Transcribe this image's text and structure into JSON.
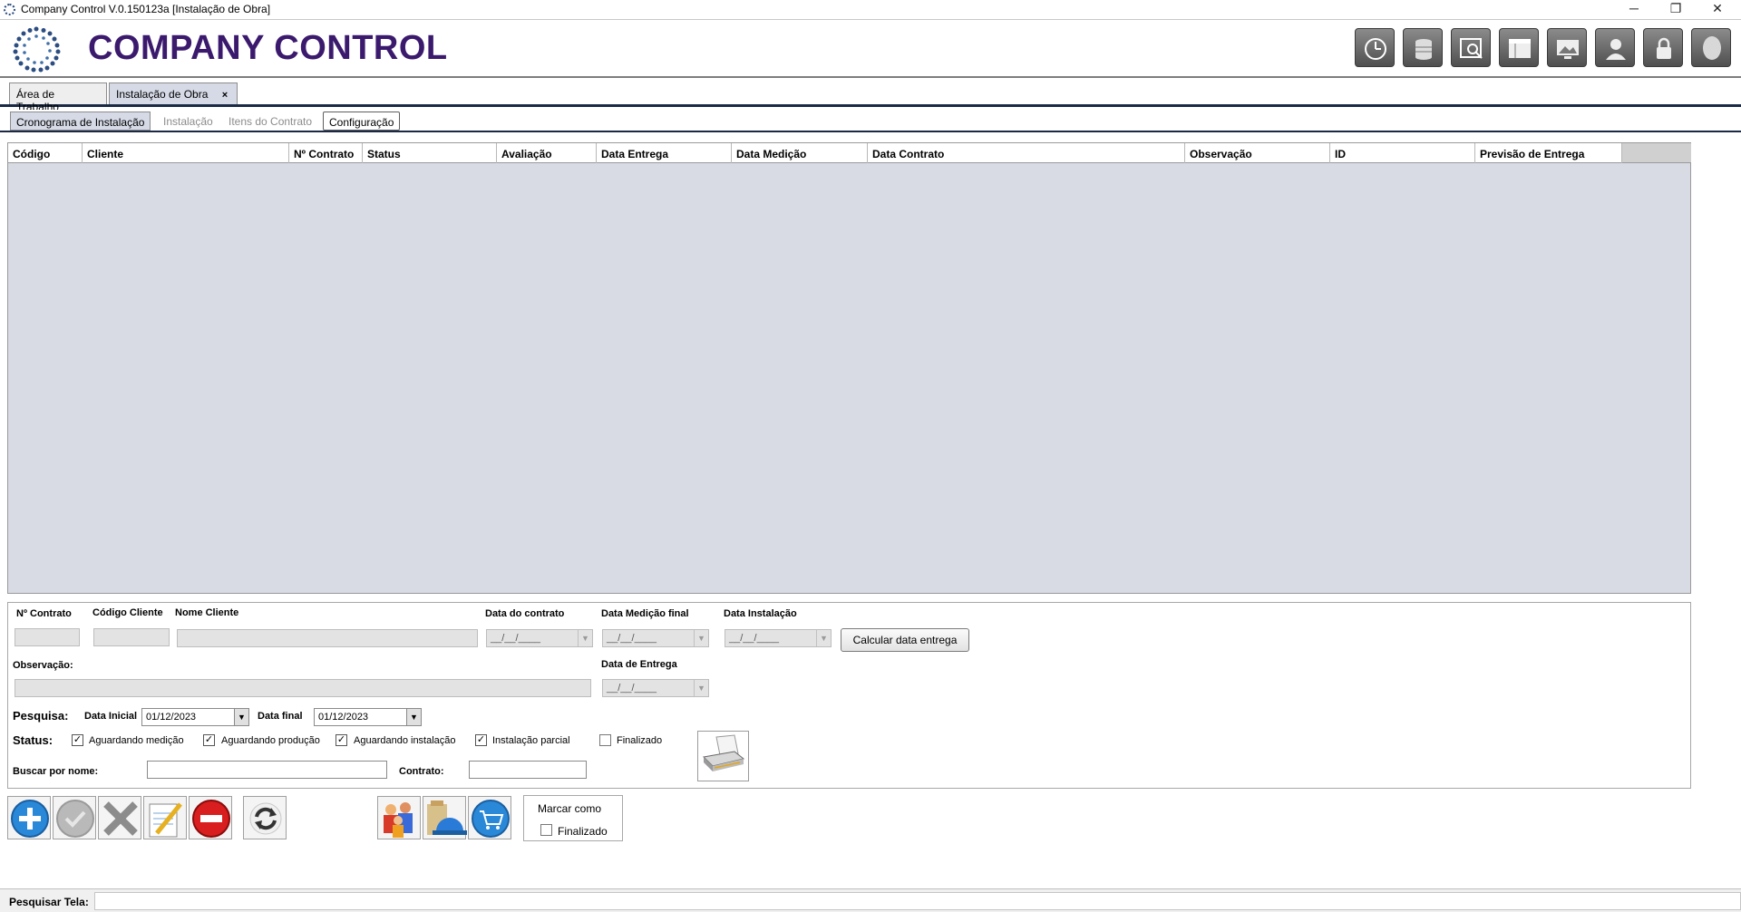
{
  "window": {
    "title": "Company Control V.0.150123a [Instalação de Obra]",
    "minimize_glyph": "─",
    "restore_glyph": "❐",
    "close_glyph": "✕"
  },
  "header": {
    "brand": "COMPANY CONTROL",
    "tools": [
      "clock-icon",
      "database-icon",
      "search-window-icon",
      "layout-icon",
      "monitor-icon",
      "user-icon",
      "lock-icon",
      "avatar-icon"
    ]
  },
  "doc_tabs": [
    {
      "label": "Área de Trabalho"
    },
    {
      "label": "Instalação de Obra",
      "close": "×"
    }
  ],
  "sub_tabs": [
    {
      "label": "Cronograma de Instalação"
    },
    {
      "label": "Instalação"
    },
    {
      "label": "Itens do Contrato"
    },
    {
      "label": "Configuração"
    }
  ],
  "grid": {
    "columns": [
      "Código",
      "Cliente",
      "Nº Contrato",
      "Status",
      "Avaliação",
      "Data Entrega",
      "Data Medição",
      "Data Contrato",
      "Observação",
      "ID",
      "Previsão de Entrega"
    ],
    "rows": []
  },
  "form": {
    "n_contrato_label": "Nº Contrato",
    "codigo_cliente_label": "Código Cliente",
    "nome_cliente_label": "Nome Cliente",
    "data_contrato_label": "Data do contrato",
    "data_medicao_label": "Data Medição final",
    "data_instalacao_label": "Data Instalação",
    "date_placeholder": "__/__/____",
    "calc_button": "Calcular data entrega",
    "observacao_label": "Observação:",
    "data_entrega_label": "Data de Entrega",
    "pesquisa_label": "Pesquisa:",
    "data_inicial_label": "Data Inicial",
    "data_inicial_value": "01/12/2023",
    "data_final_label": "Data final",
    "data_final_value": "01/12/2023",
    "status_label": "Status:",
    "status_options": [
      {
        "label": "Aguardando medição",
        "checked": true
      },
      {
        "label": "Aguardando produção",
        "checked": true
      },
      {
        "label": "Aguardando instalação",
        "checked": true
      },
      {
        "label": "Instalação parcial",
        "checked": true
      },
      {
        "label": "Finalizado",
        "checked": false
      }
    ],
    "check_glyph": "✓",
    "buscar_label": "Buscar por nome:",
    "contrato_label": "Contrato:"
  },
  "actions": {
    "mark_as_label": "Marcar como",
    "finalizado_label": "Finalizado"
  },
  "search_screen": {
    "label": "Pesquisar Tela:"
  }
}
